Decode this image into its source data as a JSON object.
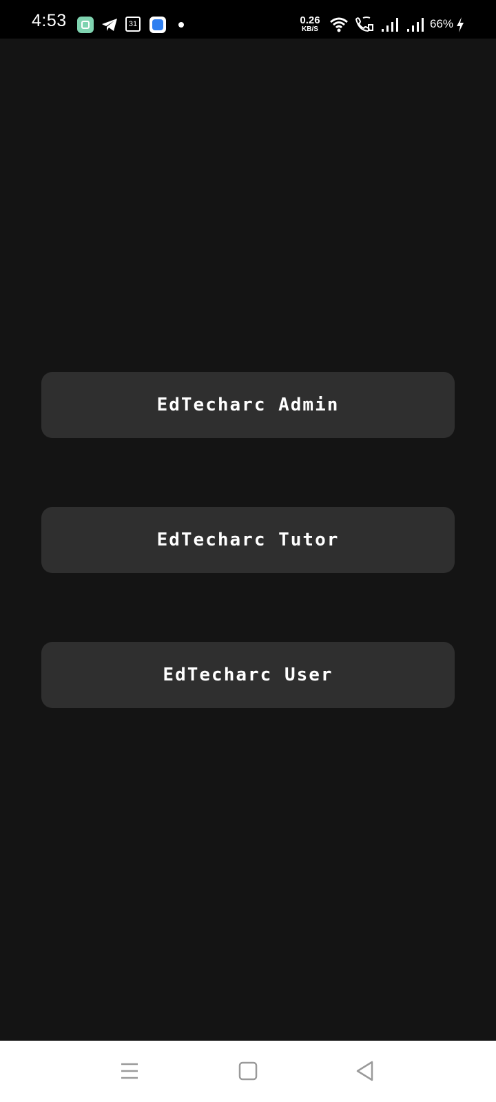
{
  "status_bar": {
    "time": "4:53",
    "calendar_day": "31",
    "net_speed_value": "0.26",
    "net_speed_unit": "KB/S",
    "battery": "66%",
    "icons": [
      "app-icon-green",
      "telegram-icon",
      "calendar-icon",
      "app-icon-blue",
      "notification-dot",
      "wifi-icon",
      "wifi-calling-icon",
      "signal-icon",
      "signal-icon",
      "charging-bolt-icon"
    ]
  },
  "main": {
    "buttons": [
      {
        "label": "EdTecharc Admin"
      },
      {
        "label": "EdTecharc Tutor"
      },
      {
        "label": "EdTecharc User"
      }
    ]
  },
  "nav_bar": {
    "icons": [
      "menu-icon",
      "home-square-icon",
      "back-triangle-icon"
    ]
  },
  "colors": {
    "background": "#141414",
    "button": "#2f2f2f",
    "status_bar": "#000000",
    "nav_bar": "#ffffff",
    "text": "#ffffff"
  }
}
